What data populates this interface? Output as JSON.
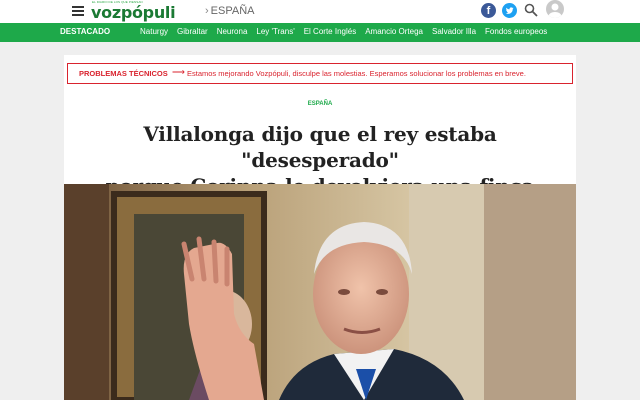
{
  "header": {
    "logo_tagline": "EL DIARIO DE LOS QUE PIENSAN",
    "logo_name": "vozpópuli",
    "breadcrumb": "ESPAÑA",
    "icons": [
      "menu-icon",
      "facebook-icon",
      "twitter-icon",
      "search-icon",
      "user-icon"
    ]
  },
  "nav": {
    "label": "DESTACADO",
    "items": [
      "Naturgy",
      "Gibraltar",
      "Neurona",
      "Ley 'Trans'",
      "El Corte Inglés",
      "Amancio Ortega",
      "Salvador Illa",
      "Fondos europeos"
    ]
  },
  "alert": {
    "title": "PROBLEMAS TÉCNICOS",
    "message": "Estamos mejorando Vozpópuli, disculpe las molestias. Esperamos solucionar los problemas en breve."
  },
  "article": {
    "section": "ESPAÑA",
    "headline_line1": "Villalonga dijo que el rey estaba \"desesperado\"",
    "headline_line2": "porque Corinna le devolviera una finca"
  },
  "colors": {
    "brand_green": "#1ea94a",
    "alert_red": "#d9232e",
    "facebook": "#3b5998",
    "twitter": "#1da1f2"
  }
}
